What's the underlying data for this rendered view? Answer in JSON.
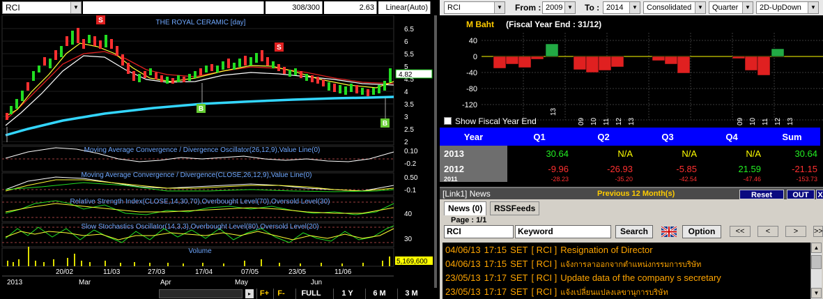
{
  "left_panel": {
    "symbol": "RCI",
    "bars_info": "308/300",
    "last_value": "2.63",
    "scale_mode": "Linear(Auto)",
    "chart_title": "THE ROYAL CERAMIC [day]",
    "price_axis": [
      "6.5",
      "6",
      "5.5",
      "5",
      "4.5",
      "4",
      "3.5",
      "3",
      "2.5",
      "2"
    ],
    "price_marker": "4.82",
    "macd_osc_label": "Moving Average Convergence / Divergence Oscillator(26,12,9),Value Line(0)",
    "macd_osc_axis": [
      "0.10",
      "-0.2"
    ],
    "macd_label": "Moving Average Convergence / Divergence(CLOSE,26,12,9),Value Line(0)",
    "macd_axis": [
      "0.50",
      "-0.1"
    ],
    "rsi_label": "Relative Strength Index(CLOSE,14,30,70),Overbought Level(70),Oversold Level(30)",
    "rsi_axis": [
      "40"
    ],
    "stoch_label": "Slow Stochastics Oscillator(14,3,3),Overbought Level(80),Oversold Level(20)",
    "stoch_axis": [
      "30"
    ],
    "volume_label": "Volume",
    "volume_marker": "5,169,600",
    "signals": [
      "S",
      "S",
      "B",
      "B"
    ],
    "date_ticks_top": [
      "20/02",
      "11/03",
      "27/03",
      "17/04",
      "07/05",
      "23/05",
      "11/06"
    ],
    "date_ticks_bottom": [
      "2013",
      "Mar",
      "Apr",
      "May",
      "Jun"
    ],
    "bottom_buttons": [
      "F+",
      "F-",
      "FULL",
      "1 Y",
      "6 M",
      "3 M"
    ]
  },
  "right_panel": {
    "symbol": "RCI",
    "from_label": "From :",
    "from_value": "2009",
    "to_label": "To :",
    "to_value": "2014",
    "statement": "Consolidated",
    "period": "Quarter",
    "view_mode": "2D-UpDown",
    "fin_chart": {
      "unit": "M Baht",
      "fiscal_note": "(Fiscal Year End : 31/12)",
      "y_ticks": [
        "40",
        "0",
        "-40",
        "-80",
        "-120"
      ],
      "x_ticks": [
        "13",
        "09",
        "10",
        "11",
        "12",
        "13",
        "09",
        "10",
        "11",
        "12",
        "13"
      ]
    },
    "show_fiscal_label": "Show Fiscal Year End",
    "table": {
      "headers": [
        "Year",
        "Q1",
        "Q2",
        "Q3",
        "Q4",
        "Sum"
      ],
      "rows": [
        {
          "year": "2013",
          "q1": "30.64",
          "q2": "N/A",
          "q3": "N/A",
          "q4": "N/A",
          "sum": "30.64"
        },
        {
          "year": "2012",
          "q1": "-9.96",
          "q2": "-26.93",
          "q3": "-5.85",
          "q4": "21.59",
          "sum": "-21.15"
        },
        {
          "year": "2011",
          "q1": "-28.23",
          "q2": "-35.20",
          "q3": "-42.54",
          "q4": "-47.46",
          "sum": "-153.73"
        }
      ]
    },
    "news": {
      "title": "[Link1] News",
      "period_label": "Previous 12 Month(s)",
      "reset": "Reset",
      "out": "OUT",
      "close": "X",
      "tabs": [
        "News (0)",
        "RSSFeeds"
      ],
      "page": "Page : 1/1",
      "symbol_value": "RCI",
      "keyword_value": "Keyword",
      "search": "Search",
      "option": "Option",
      "nav": [
        "<<",
        "<",
        ">",
        ">>"
      ],
      "items": [
        {
          "date": "04/06/13",
          "time": "17:15",
          "source": "SET",
          "sym": "[ RCI ]",
          "headline": "Resignation of Director"
        },
        {
          "date": "04/06/13",
          "time": "17:15",
          "source": "SET",
          "sym": "[ RCI ]",
          "headline": "แจ้งการลาออกจากตำแหน่งกรรมการบริษัท"
        },
        {
          "date": "23/05/13",
          "time": "17:17",
          "source": "SET",
          "sym": "[ RCI ]",
          "headline": "Update data of the company s secretary"
        },
        {
          "date": "23/05/13",
          "time": "17:17",
          "source": "SET",
          "sym": "[ RCI ]",
          "headline": "แจ้งเปลี่ยนแปลงเลขานุการบริษัท"
        }
      ]
    }
  }
}
